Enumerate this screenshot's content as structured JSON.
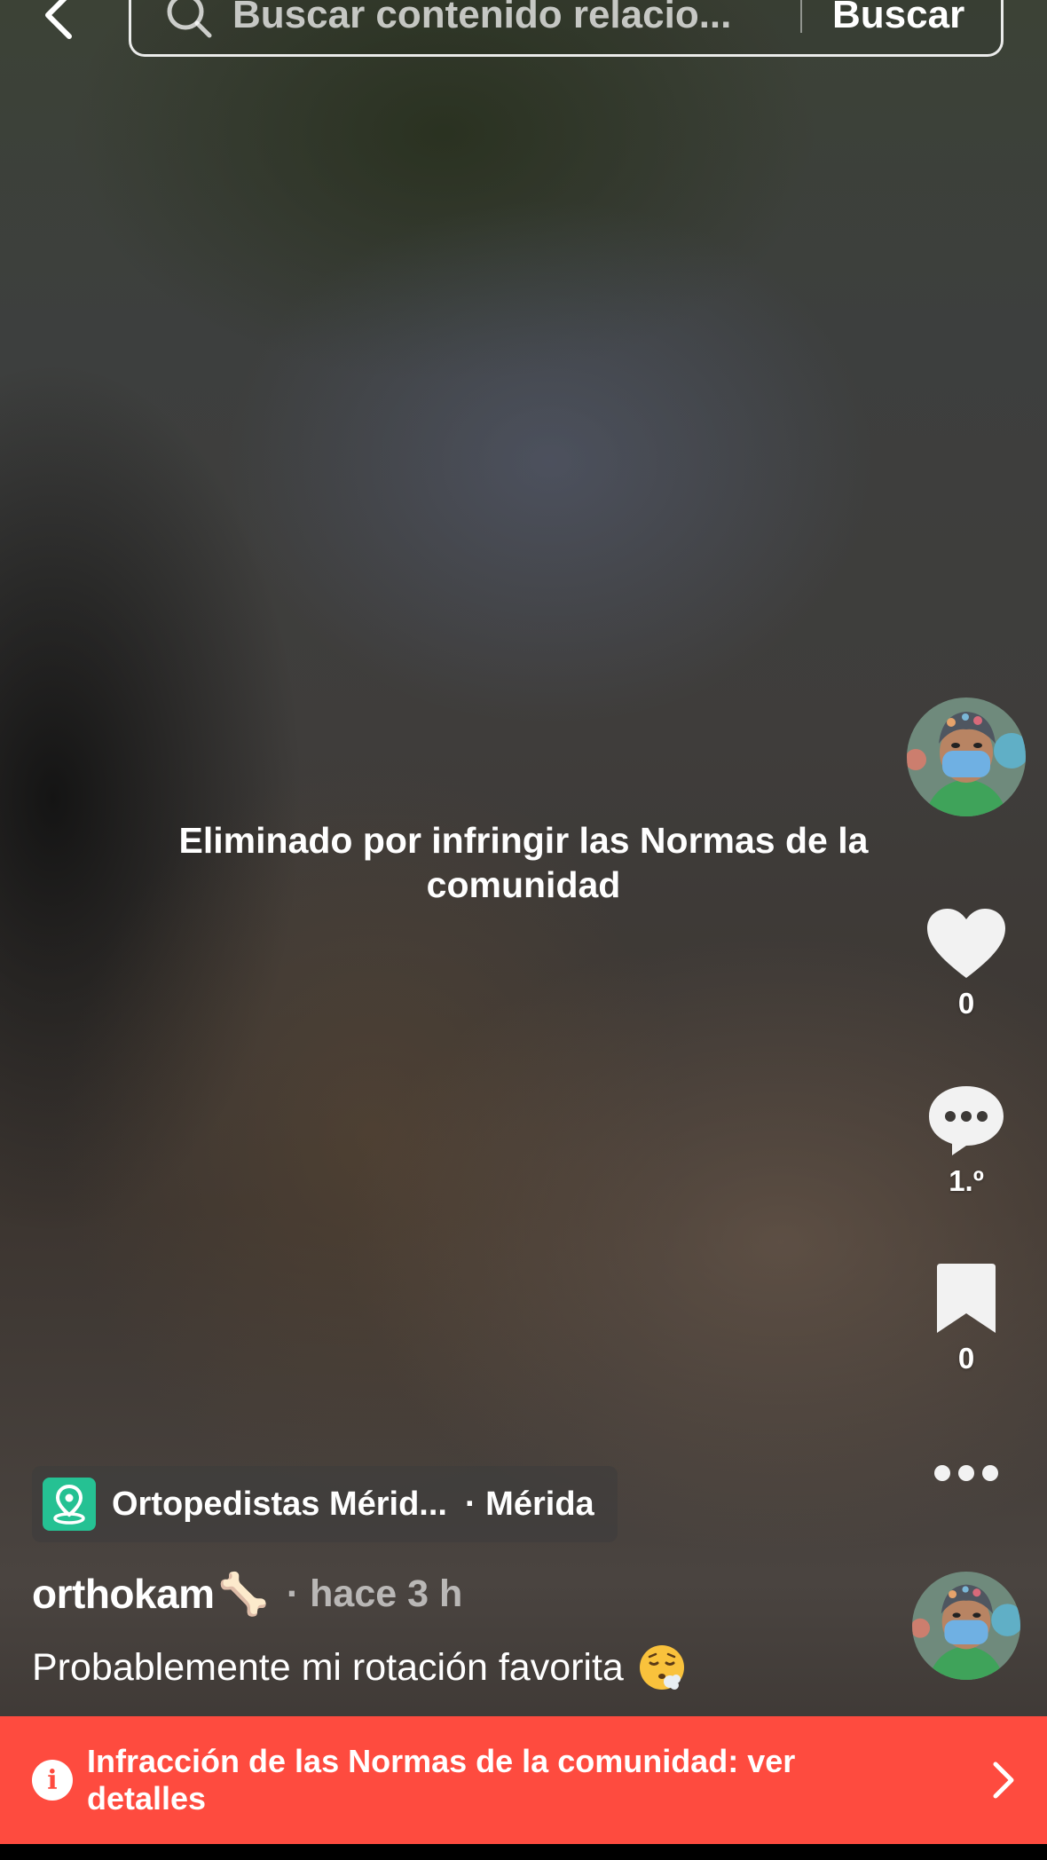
{
  "header": {
    "back_icon": "chevron-left-icon",
    "search": {
      "icon": "search-icon",
      "placeholder": "Buscar contenido relacio..."
    },
    "search_button_label": "Buscar"
  },
  "video": {
    "removed_message": "Eliminado por infringir las Normas de la comunidad"
  },
  "rail": {
    "avatar_icon": "avatar",
    "like": {
      "icon": "heart-icon",
      "count": "0"
    },
    "comment": {
      "icon": "comment-icon",
      "count": "1.º"
    },
    "bookmark": {
      "icon": "bookmark-icon",
      "count": "0"
    },
    "more_icon": "more-icon"
  },
  "post": {
    "location": {
      "icon": "location-pin-icon",
      "name": "Ortopedistas Mérid...",
      "city": "· Mérida"
    },
    "author": "orthokam",
    "author_emoji": "🦴",
    "time": "· hace 3 h",
    "caption": "Probablemente mi rotación favorita",
    "caption_emoji": "face-exhaling-icon"
  },
  "violation_banner": {
    "icon": "info-icon",
    "text": "Infracción de las Normas de la comunidad: ver detalles",
    "chevron": "chevron-right-icon"
  },
  "colors": {
    "banner_red": "#fe4b3f",
    "location_green": "#25c193"
  }
}
